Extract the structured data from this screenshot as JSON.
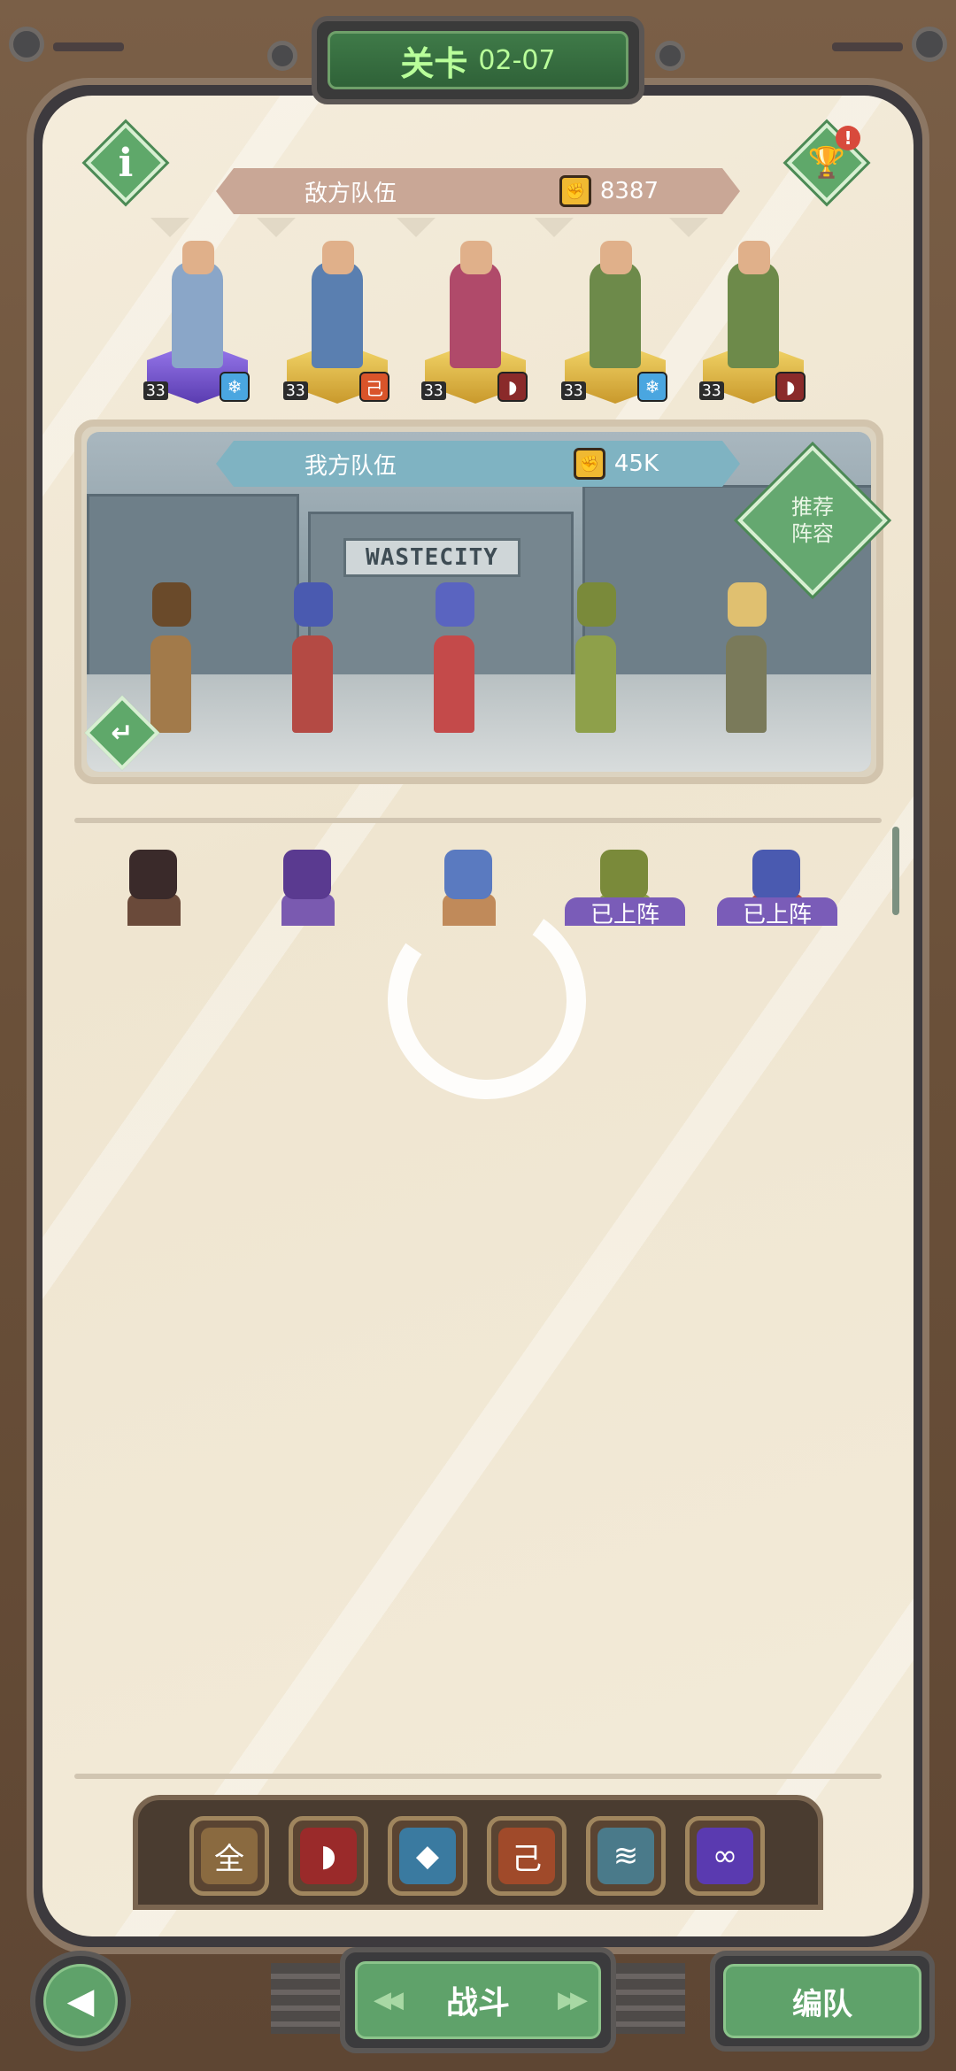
{
  "header": {
    "stage_label": "关卡",
    "stage_number": "02-07"
  },
  "info_icon": "info-icon",
  "trophy_badge": "!",
  "enemy_team": {
    "label": "敌方队伍",
    "power": "8387",
    "units": [
      {
        "level": "33",
        "pedestal": "purple",
        "element": "ice",
        "color": "#8aa6c8",
        "elem_color": "#4aa6e0",
        "elem_glyph": "❄"
      },
      {
        "level": "33",
        "pedestal": "gold",
        "element": "fire",
        "color": "#5a7fb0",
        "elem_color": "#d9542a",
        "elem_glyph": "己"
      },
      {
        "level": "33",
        "pedestal": "gold",
        "element": "red",
        "color": "#b04a6a",
        "elem_color": "#8a2a2a",
        "elem_glyph": "◗"
      },
      {
        "level": "33",
        "pedestal": "gold",
        "element": "ice",
        "color": "#6d8a4a",
        "elem_color": "#4aa6e0",
        "elem_glyph": "❄"
      },
      {
        "level": "33",
        "pedestal": "gold",
        "element": "red",
        "color": "#6d8a4a",
        "elem_color": "#8a2a2a",
        "elem_glyph": "◗"
      }
    ]
  },
  "ally_team": {
    "label": "我方队伍",
    "power": "45K",
    "scene_sign": "WASTECITY",
    "recommend_label_1": "推荐",
    "recommend_label_2": "阵容",
    "heroes": [
      {
        "color": "#a27a4a",
        "head": "#6a4a2a"
      },
      {
        "color": "#b44a44",
        "head": "#4a5ab0"
      },
      {
        "color": "#c44a4a",
        "head": "#5a64c0"
      },
      {
        "color": "#8ea04a",
        "head": "#7a8a3a"
      },
      {
        "color": "#7a7a5a",
        "head": "#e0c070"
      }
    ]
  },
  "roster": [
    {
      "color": "#6a4a3a",
      "head": "#3a2a2a",
      "deployed": false
    },
    {
      "color": "#7a5ab0",
      "head": "#5a3a90",
      "deployed": false
    },
    {
      "color": "#c08a5a",
      "head": "#5a7ac0",
      "deployed": false
    },
    {
      "color": "#8ea04a",
      "head": "#7a8a3a",
      "deployed": true
    },
    {
      "color": "#b44a44",
      "head": "#4a5ab0",
      "deployed": true
    }
  ],
  "deployed_label": "已上阵",
  "filters": [
    {
      "name": "all",
      "glyph": "全",
      "color": "#8a6a40"
    },
    {
      "name": "red",
      "glyph": "◗",
      "color": "#9a2a2a"
    },
    {
      "name": "wolf",
      "glyph": "◆",
      "color": "#3a7aa0"
    },
    {
      "name": "fire",
      "glyph": "己",
      "color": "#a04a2a"
    },
    {
      "name": "feather",
      "glyph": "≋",
      "color": "#4a7a8a"
    },
    {
      "name": "infinity",
      "glyph": "∞",
      "color": "#5a3ab0"
    }
  ],
  "buttons": {
    "fight": "战斗",
    "formation": "编队",
    "fight_arrows_left": "◀◀",
    "fight_arrows_right": "▶▶"
  },
  "colors": {
    "enemy_banner": "#c9a796",
    "ally_banner": "#7fb3c2",
    "accent_green": "#5fa26a"
  }
}
